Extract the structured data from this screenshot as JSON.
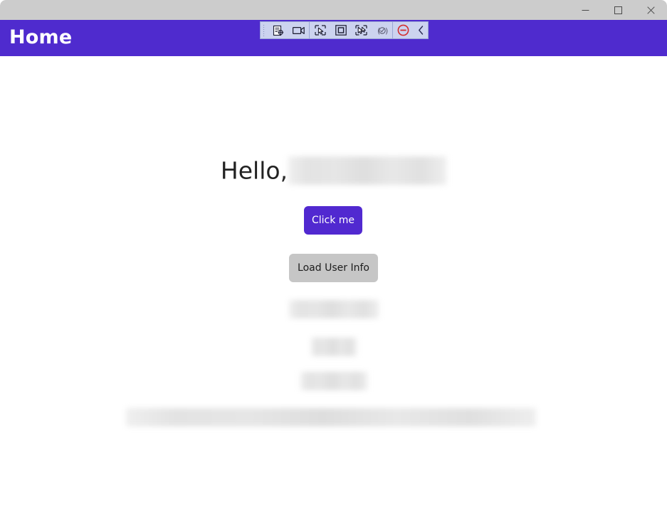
{
  "window": {
    "controls": [
      {
        "name": "minimize",
        "glyph": "minimize-icon"
      },
      {
        "name": "maximize",
        "glyph": "maximize-icon"
      },
      {
        "name": "close",
        "glyph": "close-icon"
      }
    ]
  },
  "header": {
    "title": "Home",
    "background_color": "#4f2bce",
    "title_color": "#ffffff"
  },
  "automation_toolbar": {
    "background_color": "#ccd3ef",
    "border_color": "#9aa6d4",
    "items": [
      {
        "name": "drag-handle",
        "icon": "grip-dots-icon"
      },
      {
        "name": "inspect-element",
        "icon": "document-target-icon"
      },
      {
        "name": "record-video",
        "icon": "video-camera-icon"
      },
      {
        "name": "select-pointer",
        "icon": "cursor-select-icon"
      },
      {
        "name": "select-region",
        "icon": "square-region-icon"
      },
      {
        "name": "select-multiple",
        "icon": "cursor-multi-select-icon"
      },
      {
        "name": "validate",
        "icon": "checkmark-circle-icon"
      },
      {
        "name": "stop-recording",
        "icon": "stop-circle-icon"
      },
      {
        "name": "collapse-toolbar",
        "icon": "chevron-left-icon"
      }
    ]
  },
  "main": {
    "greeting_prefix": "Hello,",
    "greeting_name_redacted": true,
    "primary_button_label": "Click me",
    "primary_button_color": "#5129d0",
    "secondary_button_label": "Load User Info",
    "secondary_button_color": "#c6c6c6",
    "redacted_lines": [
      {
        "name": "user-info-line-1",
        "redacted": true
      },
      {
        "name": "user-info-line-2",
        "redacted": true
      },
      {
        "name": "user-info-line-3",
        "redacted": true
      },
      {
        "name": "user-info-line-4",
        "redacted": true
      }
    ]
  }
}
